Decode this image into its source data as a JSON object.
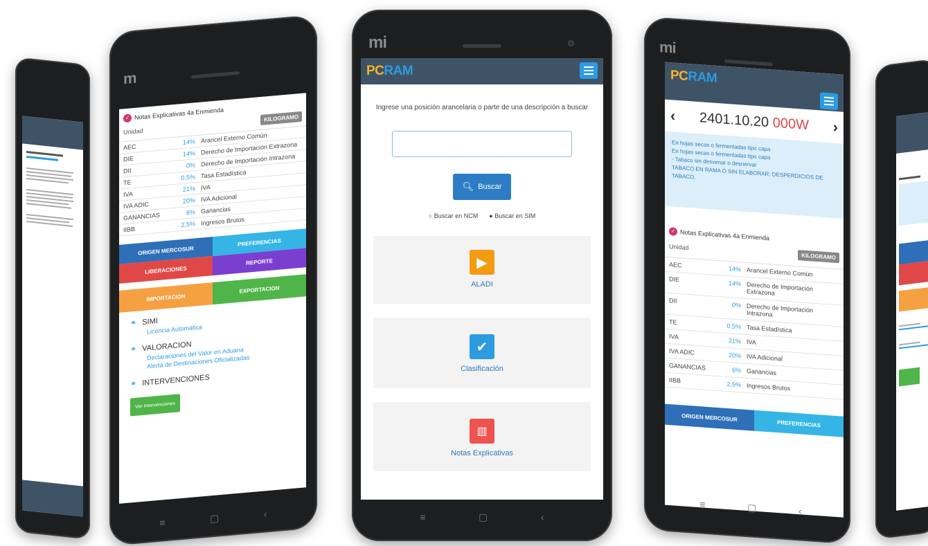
{
  "phone_c": {
    "brand": "mi",
    "logo_pc": "PC",
    "logo_ram": "RAM",
    "prompt": "Ingrese una posición arancelaria o parte de una descripción a buscar",
    "search_placeholder": "",
    "search_button": "Buscar",
    "radio_ncm": "Buscar en NCM",
    "radio_sim": "Buscar en SIM",
    "cards": [
      {
        "label": "ALADI",
        "icon": "map-icon",
        "color": "#f39c12"
      },
      {
        "label": "Clasificación",
        "icon": "check-icon",
        "color": "#2d9be0"
      },
      {
        "label": "Notas Explicativas",
        "icon": "book-icon",
        "color": "#ef5350"
      }
    ],
    "softkeys": [
      "≡",
      "▢",
      "‹"
    ]
  },
  "phone_d": {
    "brand": "mi",
    "code_main": "2401.10.20",
    "code_suffix": "000W",
    "desc_lines": [
      "En hojas secas o fermentadas tipo capa",
      "En hojas secas o fermentadas tipo capa",
      "- Tabaco sin desvenar o desnervar",
      "TABACO EN RAMA O SIN ELABORAR; DESPERDICIOS DE TABACO."
    ],
    "notes_header": "Notas Explicativas 4a Enmienda",
    "unit_label": "Unidad",
    "unit_value": "KILOGRAMO",
    "rows": [
      {
        "k": "AEC",
        "v": "14%",
        "d": "Arancel Externo Común"
      },
      {
        "k": "DIE",
        "v": "14%",
        "d": "Derecho de Importación Extrazona"
      },
      {
        "k": "DII",
        "v": "0%",
        "d": "Derecho de Importación Intrazona"
      },
      {
        "k": "TE",
        "v": "0,5%",
        "d": "Tasa Estadística"
      },
      {
        "k": "IVA",
        "v": "21%",
        "d": "IVA"
      },
      {
        "k": "IVA ADIC",
        "v": "20%",
        "d": "IVA Adicional"
      },
      {
        "k": "GANANCIAS",
        "v": "6%",
        "d": "Ganancias"
      },
      {
        "k": "IIBB",
        "v": "2,5%",
        "d": "Ingresos Brutos"
      }
    ],
    "buttons": [
      "ORIGEN MERCOSUR",
      "PREFERENCIAS"
    ]
  },
  "phone_b": {
    "notes_header": "Notas Explicativas 4a Enmienda",
    "unit_label": "Unidad",
    "unit_value": "KILOGRAMO",
    "rows": [
      {
        "k": "AEC",
        "v": "14%",
        "d": "Arancel Externo Común"
      },
      {
        "k": "DIE",
        "v": "14%",
        "d": "Derecho de Importación Extrazona"
      },
      {
        "k": "DII",
        "v": "0%",
        "d": "Derecho de Importación Intrazona"
      },
      {
        "k": "TE",
        "v": "0,5%",
        "d": "Tasa Estadística"
      },
      {
        "k": "IVA",
        "v": "21%",
        "d": "IVA"
      },
      {
        "k": "IVA ADIC",
        "v": "20%",
        "d": "IVA Adicional"
      },
      {
        "k": "GANANCIAS",
        "v": "6%",
        "d": "Ganancias"
      },
      {
        "k": "IIBB",
        "v": "2,5%",
        "d": "Ingresos Brutos"
      }
    ],
    "btn_row1": [
      "ORIGEN MERCOSUR",
      "PREFERENCIAS"
    ],
    "btn_row2": [
      "LIBERACIONES",
      "REPORTE"
    ],
    "btn_row3": [
      "IMPORTACION",
      "EXPORTACION"
    ],
    "simi_title": "SIMI",
    "simi_link": "Licencia Automática",
    "val_title": "VALORACION",
    "val_link1": "Declaraciones del Valor en Aduana",
    "val_link2": "Alerta de Destinaciones Oficializadas",
    "int_title": "INTERVENCIONES",
    "green_btn": "Ver Intervenciones"
  },
  "colors": {
    "accent": "#2d9be0",
    "brand_orange": "#f4b428",
    "header": "#3f5366",
    "red": "#e04848",
    "purple": "#7b3fd0",
    "orange": "#f5a142",
    "green": "#4fb548"
  }
}
